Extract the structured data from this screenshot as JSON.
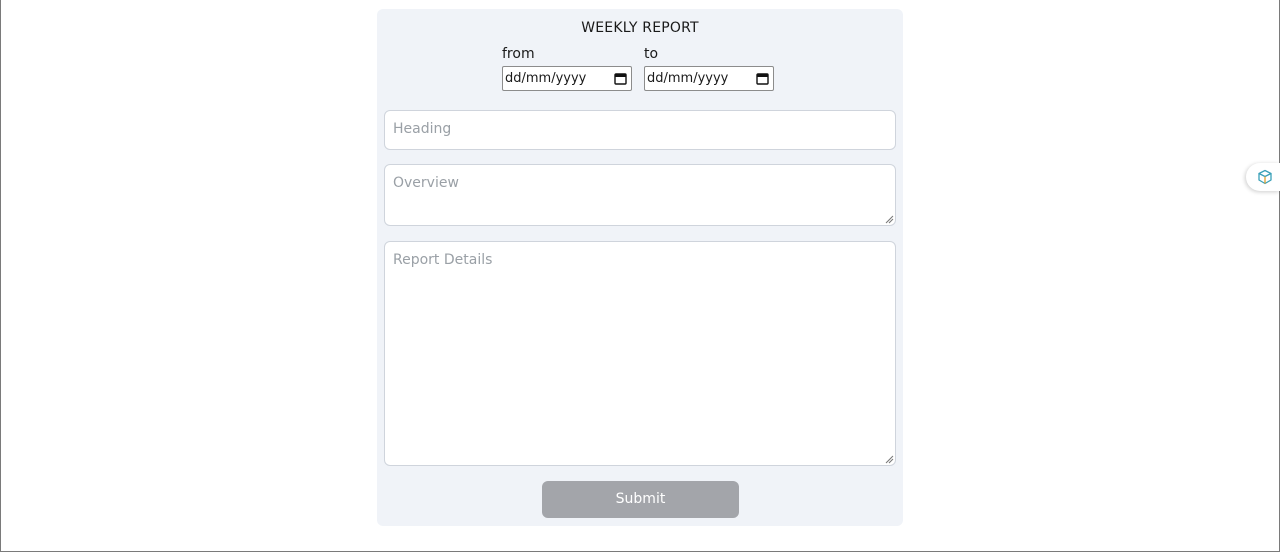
{
  "form": {
    "title": "WEEKLY REPORT",
    "from_label": "from",
    "to_label": "to",
    "from_date_placeholder": "dd/mm/yyyy",
    "to_date_placeholder": "dd/mm/yyyy",
    "heading_placeholder": "Heading",
    "overview_placeholder": "Overview",
    "details_placeholder": "Report Details",
    "submit_label": "Submit"
  },
  "side_widget": {
    "icon": "cube-extension-icon"
  },
  "colors": {
    "card_background": "#f0f3f8",
    "submit_button": "#a3a5aa",
    "placeholder_text": "#9aa0a6",
    "widget_icon": "#3aa0b8"
  }
}
